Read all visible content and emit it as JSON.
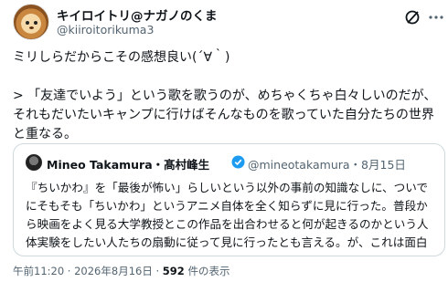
{
  "author": {
    "display_name": "キイロイトリ@ナガノのくま",
    "handle": "@kiiroitorikuma3"
  },
  "icons": {
    "grok": "grok-icon",
    "more": "more-icon",
    "verified": "verified-badge-icon"
  },
  "post": {
    "lines": [
      "ミリしらだからこその感想良い(´∀｀)",
      "> 「友達でいよう」という歌を歌うのが、めちゃくちゃ白々しいのだが、",
      "それもだいたいキャンプに行けばそんなものを歌っていた自分たちの世界",
      "と重なる。"
    ]
  },
  "quote": {
    "display_name": "Mineo Takamura・髙村峰生",
    "handle_time": "@mineotakamura・8月15日",
    "lines": [
      "『ちいかわ』を「最後が怖い」らしいという以外の事前の知識なしに、ついで",
      "にそもそも「ちいかわ」というアニメ自体を全く知らずに見に行った。普段か",
      "ら映画をよく見る大学教授とこの作品を出合わせると何が起きるのかという人",
      "体実験をしたい人たちの扇動に従って見に行ったとも言える。が、これは面白"
    ]
  },
  "meta": {
    "time": "午前11:20 · 2026年8月16日 · ",
    "views": "592",
    "views_label": " 件の表示"
  },
  "colors": {
    "text": "#0f1419",
    "muted": "#536471",
    "border": "#cfd9de",
    "verified": "#1d9bf0"
  }
}
